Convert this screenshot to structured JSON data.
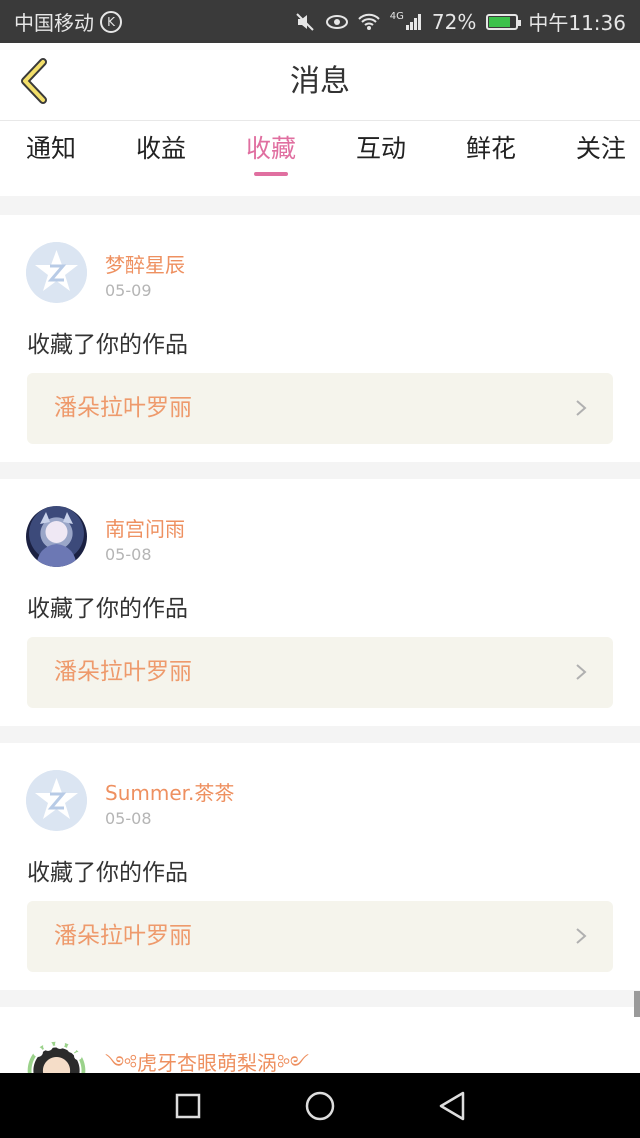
{
  "status_bar": {
    "carrier": "中国移动",
    "carrier_badge": "K",
    "network": "4G",
    "battery": "72%",
    "battery_level": 0.72,
    "time": "中午11:36"
  },
  "header": {
    "title": "消息",
    "back_icon": "chevron-left-icon"
  },
  "tabs": [
    {
      "label": "通知",
      "active": false
    },
    {
      "label": "收益",
      "active": false
    },
    {
      "label": "收藏",
      "active": true
    },
    {
      "label": "互动",
      "active": false
    },
    {
      "label": "鲜花",
      "active": false
    },
    {
      "label": "关注",
      "active": false
    }
  ],
  "messages": [
    {
      "user": "梦醉星辰",
      "date": "05-09",
      "action": "收藏了你的作品",
      "work": "潘朵拉叶罗丽",
      "avatar": "default-star-avatar"
    },
    {
      "user": "南宫问雨",
      "date": "05-08",
      "action": "收藏了你的作品",
      "work": "潘朵拉叶罗丽",
      "avatar": "photo-avatar"
    },
    {
      "user": "Summer.茶茶",
      "date": "05-08",
      "action": "收藏了你的作品",
      "work": "潘朵拉叶罗丽",
      "avatar": "default-star-avatar"
    },
    {
      "user": "༺虎牙杏眼萌梨涡༻",
      "avatar": "photo-avatar"
    }
  ],
  "colors": {
    "accent": "#e06fa0",
    "username": "#ee9060",
    "work_title": "#ee9a6c",
    "work_box": "#f5f4ec"
  }
}
